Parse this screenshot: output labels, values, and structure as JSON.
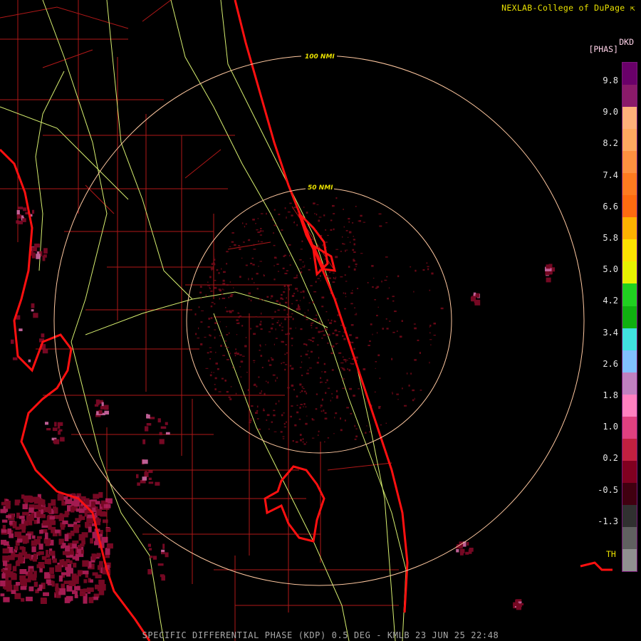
{
  "credit": "NEXLAB-College of DuPage",
  "credit_icon": "cursor-arrow-icon",
  "product_code": "DKD",
  "units": "[PHAS]",
  "footer": "SPECIFIC DIFFERENTIAL PHASE (KDP) 0.5 DEG - KMLB 23 JUN 25 22:48",
  "range_rings": [
    {
      "label": "100 NMI"
    },
    {
      "label": "50 NMI"
    }
  ],
  "legend": {
    "ticks": [
      "9.8",
      "9.0",
      "8.2",
      "7.4",
      "6.6",
      "5.8",
      "5.0",
      "4.2",
      "3.4",
      "2.6",
      "1.8",
      "1.0",
      "0.2",
      "-0.5",
      "-1.3"
    ],
    "below_threshold_label": "TH",
    "colors": [
      "#6a006a",
      "#8a1a6a",
      "#ffb07a",
      "#ffa860",
      "#ff9040",
      "#ff7a20",
      "#ff6a10",
      "#ffb000",
      "#ffe000",
      "#e8f000",
      "#20d020",
      "#10b010",
      "#40e0e0",
      "#80c0ff",
      "#c080c0",
      "#ff80c0",
      "#e04080",
      "#c02040",
      "#800020",
      "#400010",
      "#303030",
      "#606060",
      "#909090"
    ]
  },
  "colors": {
    "background": "#000000",
    "coastline": "#ff1010",
    "county_lines": "#b01818",
    "highways": "#d8f070",
    "range_ring": "#ffc8a0",
    "label_yellow": "#e8e000"
  }
}
